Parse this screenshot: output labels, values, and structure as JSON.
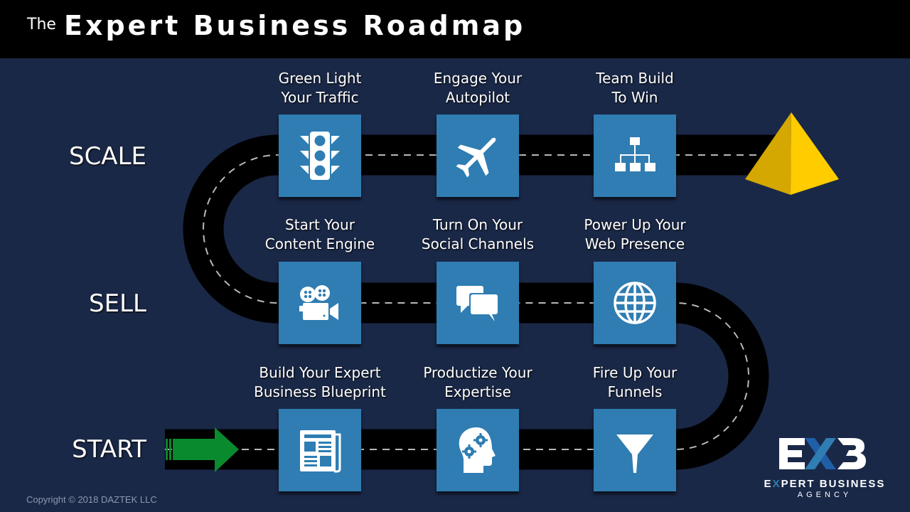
{
  "header": {
    "title_prefix": "The",
    "title": "Expert Business Roadmap"
  },
  "stages": [
    {
      "label": "SCALE"
    },
    {
      "label": "SELL"
    },
    {
      "label": "START"
    }
  ],
  "steps": {
    "scale": [
      {
        "label_line1": "Green Light",
        "label_line2": "Your Traffic",
        "icon": "traffic-light-icon"
      },
      {
        "label_line1": "Engage Your",
        "label_line2": "Autopilot",
        "icon": "airplane-icon"
      },
      {
        "label_line1": "Team Build",
        "label_line2": "To Win",
        "icon": "org-chart-icon"
      }
    ],
    "sell": [
      {
        "label_line1": "Start Your",
        "label_line2": "Content Engine",
        "icon": "video-camera-icon"
      },
      {
        "label_line1": "Turn On Your",
        "label_line2": "Social Channels",
        "icon": "chat-bubbles-icon"
      },
      {
        "label_line1": "Power Up Your",
        "label_line2": "Web Presence",
        "icon": "globe-icon"
      }
    ],
    "start": [
      {
        "label_line1": "Build Your Expert",
        "label_line2": "Business Blueprint",
        "icon": "newspaper-icon"
      },
      {
        "label_line1": "Productize Your",
        "label_line2": "Expertise",
        "icon": "head-gears-icon"
      },
      {
        "label_line1": "Fire Up Your",
        "label_line2": "Funnels",
        "icon": "funnel-icon"
      }
    ]
  },
  "goal": {
    "icon": "gold-pyramid-icon"
  },
  "start_marker": {
    "icon": "green-arrow-icon"
  },
  "logo": {
    "mark": "EXB",
    "line1_pre": "E",
    "line1_x": "X",
    "line1_post": "PERT BUSINESS",
    "line2": "AGENCY"
  },
  "footer": {
    "copyright": "Copyright © 2018 DAZTEK LLC"
  },
  "colors": {
    "background": "#1a2847",
    "tile": "#2f7db2",
    "road": "#000000",
    "arrow": "#0a8a2e",
    "pyramid": "#f0c000"
  }
}
